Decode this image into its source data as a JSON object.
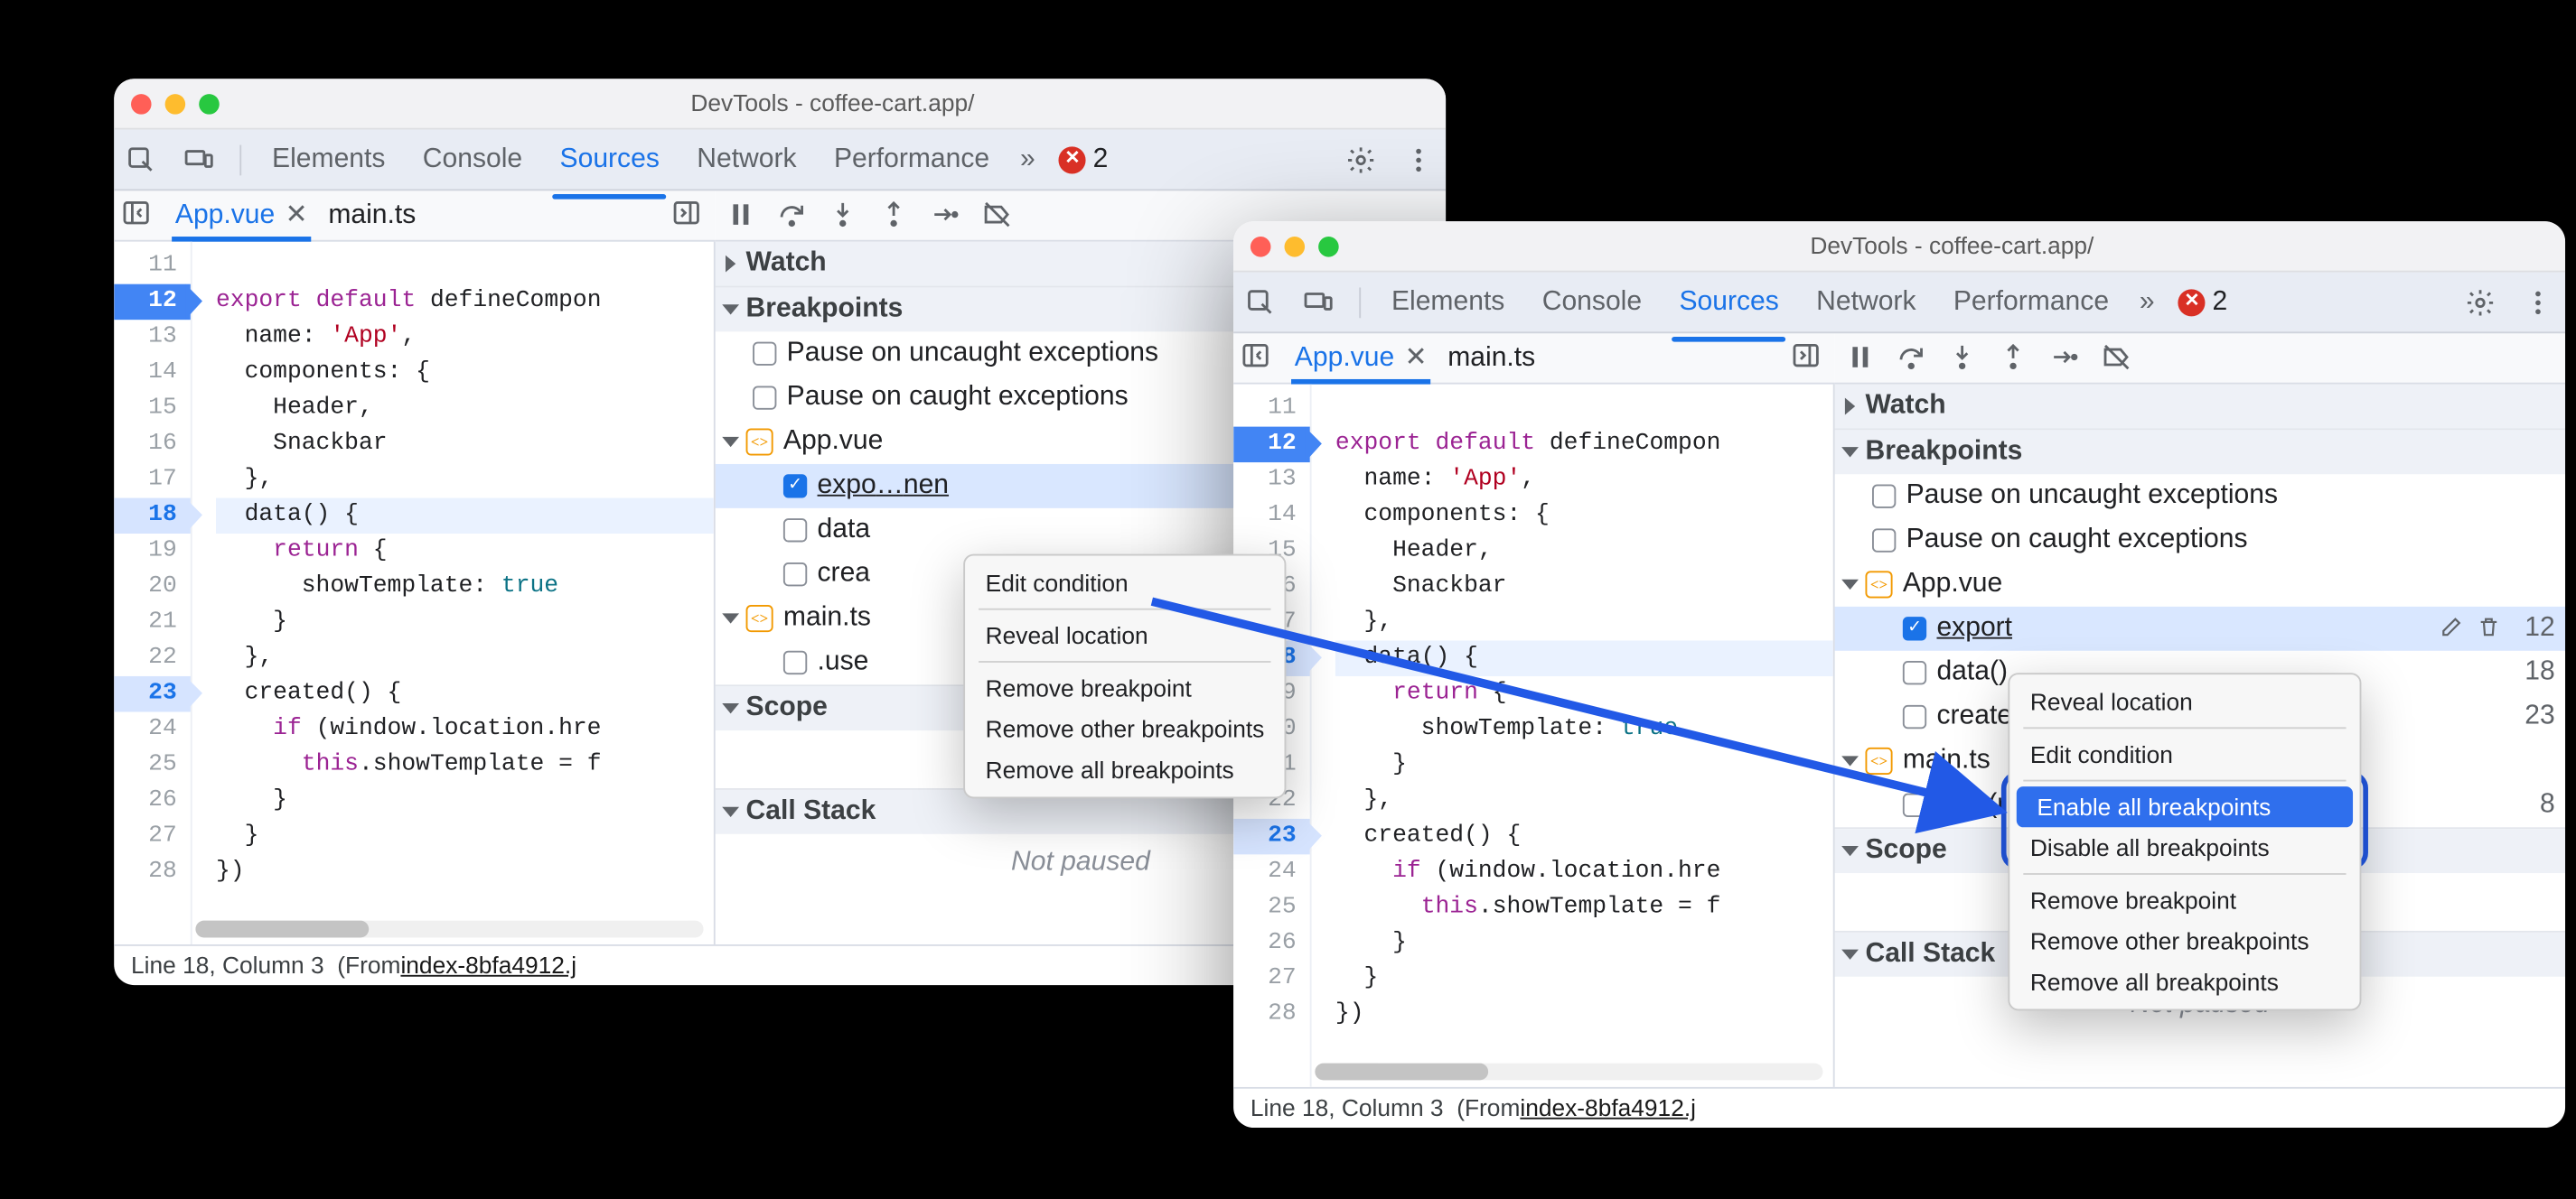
{
  "window_title": "DevTools - coffee-cart.app/",
  "tabs": {
    "elements": "Elements",
    "console": "Console",
    "sources": "Sources",
    "network": "Network",
    "performance": "Performance"
  },
  "error_count": "2",
  "file_tabs": {
    "app_vue": "App.vue",
    "main_ts": "main.ts"
  },
  "code": {
    "lines": [
      {
        "n": "11",
        "t": ""
      },
      {
        "n": "12",
        "t": "export default defineCompon"
      },
      {
        "n": "13",
        "t": "  name: 'App',"
      },
      {
        "n": "14",
        "t": "  components: {"
      },
      {
        "n": "15",
        "t": "    Header,"
      },
      {
        "n": "16",
        "t": "    Snackbar"
      },
      {
        "n": "17",
        "t": "  },"
      },
      {
        "n": "18",
        "t": "  data() {"
      },
      {
        "n": "19",
        "t": "    return {"
      },
      {
        "n": "20",
        "t": "      showTemplate: true"
      },
      {
        "n": "21",
        "t": "    }"
      },
      {
        "n": "22",
        "t": "  },"
      },
      {
        "n": "23",
        "t": "  created() {"
      },
      {
        "n": "24",
        "t": "    if (window.location.hre"
      },
      {
        "n": "25",
        "t": "      this.showTemplate = f"
      },
      {
        "n": "26",
        "t": "    }"
      },
      {
        "n": "27",
        "t": "  }"
      },
      {
        "n": "28",
        "t": "})"
      }
    ]
  },
  "sections": {
    "watch": "Watch",
    "breakpoints": "Breakpoints",
    "scope": "Scope",
    "call_stack": "Call Stack"
  },
  "bp_options": {
    "uncaught": "Pause on uncaught exceptions",
    "caught": "Pause on caught exceptions"
  },
  "bp_files": {
    "app_vue": {
      "label": "App.vue",
      "items": [
        {
          "text": "export default defineCompon",
          "line": "12",
          "truncA": "expo",
          "truncA_rest": "nen"
        },
        {
          "text_a": "data",
          "text_b": "data()",
          "line": "18"
        },
        {
          "text_a": "crea",
          "text_b": "created(",
          "line": "23"
        }
      ]
    },
    "main_ts": {
      "label": "main.ts",
      "label_b": "main.ts",
      "items": [
        {
          "text_a": ".use",
          "text_b": ".use(r",
          "line": "8"
        }
      ]
    }
  },
  "bp_list_b": {
    "app": [
      {
        "txt": "export",
        "rest": "",
        "line": "12"
      },
      {
        "txt": "data()",
        "line": "18"
      },
      {
        "txt": "create",
        "line": "23"
      }
    ],
    "main": [
      {
        "txt": ".use(r",
        "line": "8"
      }
    ]
  },
  "not_paused": "Not paused",
  "status_line": {
    "pos": "Line 18, Column 3",
    "from": "(From ",
    "file": "index-8bfa4912.j"
  },
  "context_a": {
    "edit": "Edit condition",
    "reveal": "Reveal location",
    "remove": "Remove breakpoint",
    "remove_other": "Remove other breakpoints",
    "remove_all": "Remove all breakpoints"
  },
  "context_b": {
    "reveal": "Reveal location",
    "edit": "Edit condition",
    "enable_all": "Enable all breakpoints",
    "disable_all": "Disable all breakpoints",
    "remove": "Remove breakpoint",
    "remove_other": "Remove other breakpoints",
    "remove_all": "Remove all breakpoints"
  }
}
